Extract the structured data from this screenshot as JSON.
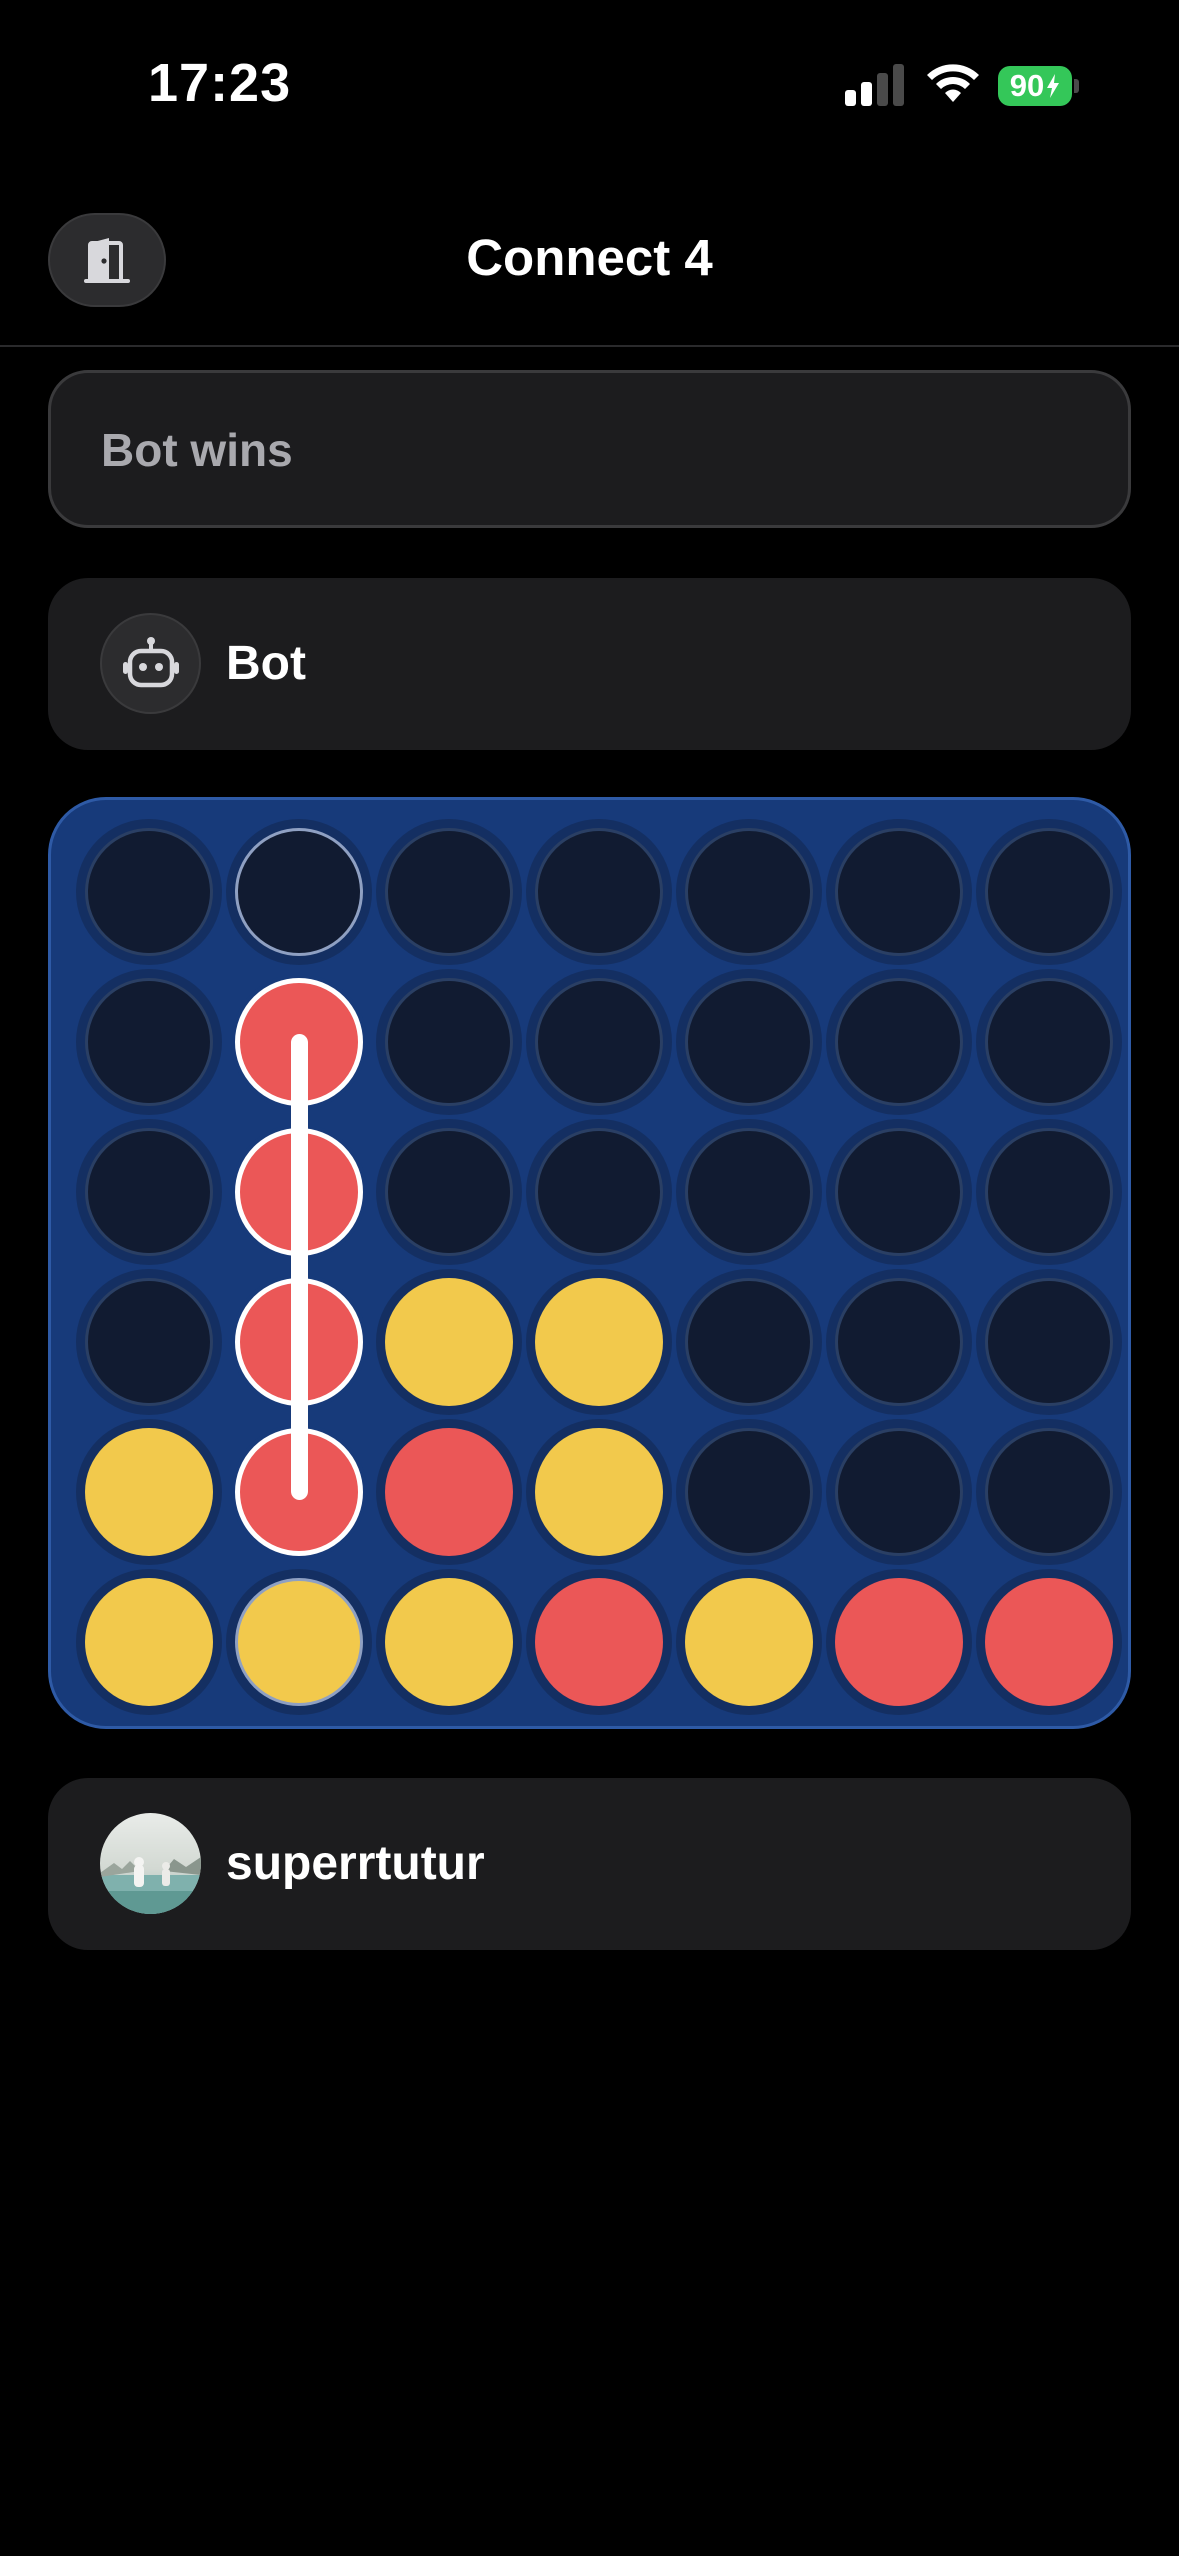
{
  "status_bar": {
    "time": "17:23",
    "battery_level": "90",
    "battery_color": "#34c759",
    "signal_bars_active": 2,
    "signal_bars_total": 4
  },
  "header": {
    "title": "Connect 4",
    "exit_icon": "door-exit-icon"
  },
  "game": {
    "status": "Bot wins",
    "opponent": {
      "name": "Bot",
      "avatar_icon": "robot-icon"
    },
    "player": {
      "name": "superrtutur",
      "avatar_icon": "user-photo"
    }
  },
  "colors": {
    "background": "#000000",
    "card": "#1c1c1e",
    "board": "#173a7a",
    "red_piece": "#eb5757",
    "yellow_piece": "#f2c94c",
    "empty_slot": "#111b31"
  },
  "board": {
    "columns": 7,
    "rows": 6,
    "grid": [
      [
        "",
        "",
        "",
        "",
        "",
        "",
        ""
      ],
      [
        "",
        "R",
        "",
        "",
        "",
        "",
        ""
      ],
      [
        "",
        "R",
        "",
        "",
        "",
        "",
        ""
      ],
      [
        "",
        "R",
        "Y",
        "Y",
        "",
        "",
        ""
      ],
      [
        "Y",
        "R",
        "R",
        "Y",
        "",
        "",
        ""
      ],
      [
        "Y",
        "Y",
        "Y",
        "R",
        "Y",
        "R",
        "R"
      ]
    ],
    "winning_line": {
      "column": 2,
      "from_row": 2,
      "to_row": 5
    },
    "highlighted_column": 2
  }
}
